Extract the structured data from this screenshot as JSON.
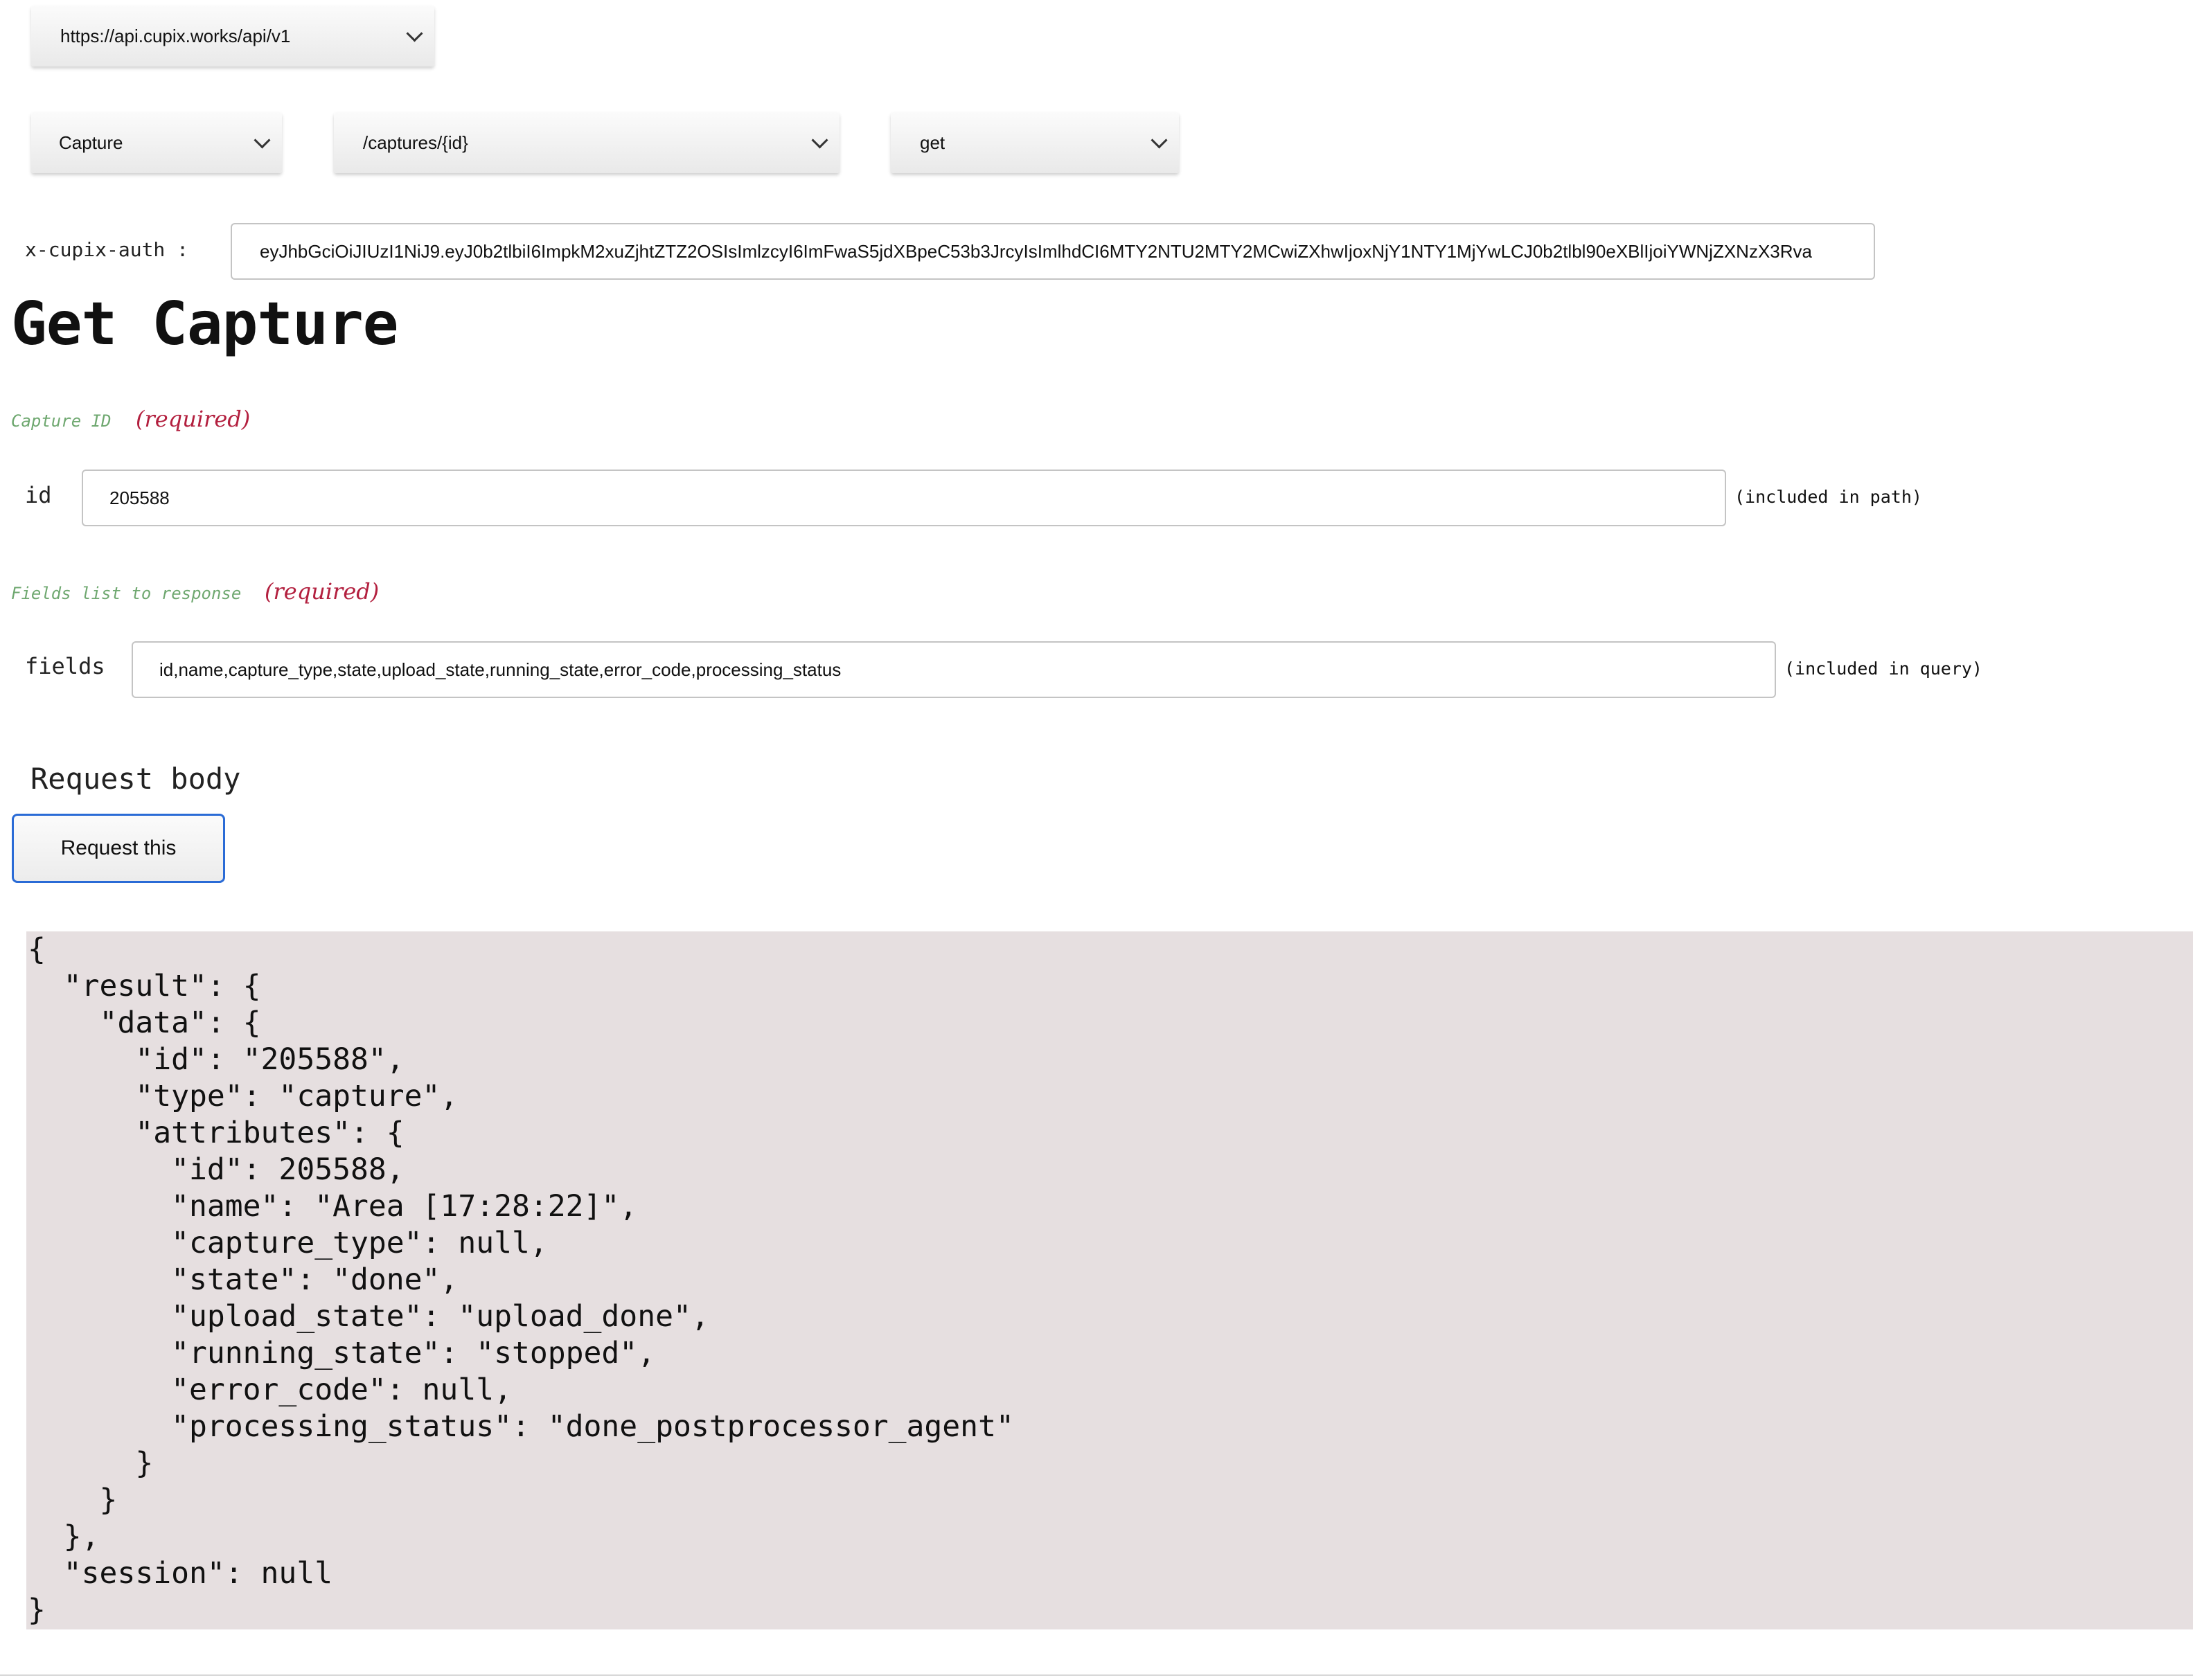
{
  "server": {
    "selected": "https://api.cupix.works/api/v1"
  },
  "resource": {
    "selected": "Capture"
  },
  "path": {
    "selected": "/captures/{id}"
  },
  "method": {
    "selected": "get"
  },
  "auth": {
    "label": "x-cupix-auth :",
    "value": "eyJhbGciOiJIUzI1NiJ9.eyJ0b2tlbiI6ImpkM2xuZjhtZTZ2OSIsImlzcyI6ImFwaS5jdXBpeC53b3JrcyIsImlhdCI6MTY2NTU2MTY2MCwiZXhwIjoxNjY1NTY1MjYwLCJ0b2tlbl90eXBlIjoiYWNjZXNzX3Rva"
  },
  "page": {
    "title": "Get Capture"
  },
  "params": [
    {
      "description": "Capture ID",
      "required_label": "(required)",
      "name": "id",
      "value": "205588",
      "location_note": "(included in path)"
    },
    {
      "description": "Fields list to response",
      "required_label": "(required)",
      "name": "fields",
      "value": "id,name,capture_type,state,upload_state,running_state,error_code,processing_status",
      "location_note": "(included in query)"
    }
  ],
  "request_body": {
    "title": "Request body"
  },
  "request_button": {
    "label": "Request this"
  },
  "response": {
    "text": "{\n  \"result\": {\n    \"data\": {\n      \"id\": \"205588\",\n      \"type\": \"capture\",\n      \"attributes\": {\n        \"id\": 205588,\n        \"name\": \"Area [17:28:22]\",\n        \"capture_type\": null,\n        \"state\": \"done\",\n        \"upload_state\": \"upload_done\",\n        \"running_state\": \"stopped\",\n        \"error_code\": null,\n        \"processing_status\": \"done_postprocessor_agent\"\n      }\n    }\n  },\n  \"session\": null\n}"
  }
}
